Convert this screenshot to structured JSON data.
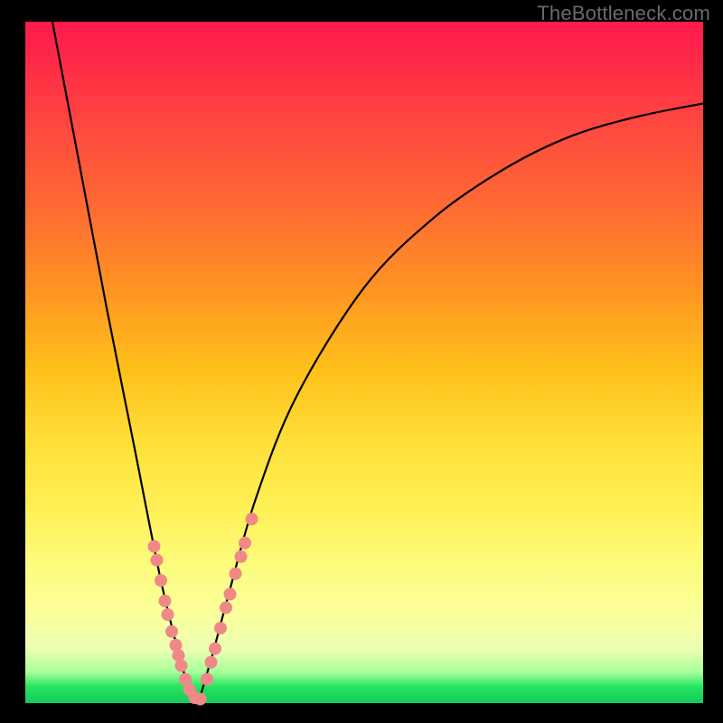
{
  "watermark": "TheBottleneck.com",
  "chart_data": {
    "type": "line",
    "title": "",
    "xlabel": "",
    "ylabel": "",
    "xlim": [
      0,
      100
    ],
    "ylim": [
      0,
      100
    ],
    "description": "Asymmetric V-shaped bottleneck curve over a rainbow gradient (red=top, green=bottom). Curve minimum near x≈25, y≈0. Left branch rises steeply to top-left; right branch rises more slowly toward upper-right. Pink marker clusters along both branches near the minimum.",
    "series": [
      {
        "name": "bottleneck-curve",
        "x": [
          4,
          8,
          12,
          16,
          20,
          23,
          25,
          27,
          30,
          34,
          40,
          50,
          60,
          70,
          80,
          90,
          100
        ],
        "y": [
          100,
          79,
          58,
          38,
          18,
          6,
          0,
          5,
          16,
          30,
          45,
          61,
          71,
          78,
          83,
          86,
          88
        ]
      }
    ],
    "markers": [
      {
        "branch": "left",
        "x": 19.0,
        "y": 23
      },
      {
        "branch": "left",
        "x": 19.4,
        "y": 21
      },
      {
        "branch": "left",
        "x": 20.0,
        "y": 18
      },
      {
        "branch": "left",
        "x": 20.6,
        "y": 15
      },
      {
        "branch": "left",
        "x": 21.0,
        "y": 13
      },
      {
        "branch": "left",
        "x": 21.6,
        "y": 10.5
      },
      {
        "branch": "left",
        "x": 22.2,
        "y": 8.5
      },
      {
        "branch": "left",
        "x": 22.6,
        "y": 7.0
      },
      {
        "branch": "left",
        "x": 23.0,
        "y": 5.5
      },
      {
        "branch": "left",
        "x": 23.6,
        "y": 3.5
      },
      {
        "branch": "left",
        "x": 24.2,
        "y": 2.0
      },
      {
        "branch": "left",
        "x": 25.0,
        "y": 0.8
      },
      {
        "branch": "left",
        "x": 25.8,
        "y": 0.6
      },
      {
        "branch": "right",
        "x": 26.8,
        "y": 3.5
      },
      {
        "branch": "right",
        "x": 27.4,
        "y": 6.0
      },
      {
        "branch": "right",
        "x": 28.0,
        "y": 8.0
      },
      {
        "branch": "right",
        "x": 28.8,
        "y": 11.0
      },
      {
        "branch": "right",
        "x": 29.6,
        "y": 14.0
      },
      {
        "branch": "right",
        "x": 30.2,
        "y": 16.0
      },
      {
        "branch": "right",
        "x": 31.0,
        "y": 19.0
      },
      {
        "branch": "right",
        "x": 31.8,
        "y": 21.5
      },
      {
        "branch": "right",
        "x": 32.4,
        "y": 23.5
      },
      {
        "branch": "right",
        "x": 33.4,
        "y": 27.0
      }
    ],
    "colors": {
      "curve": "#000000",
      "marker_fill": "#f08888",
      "gradient_top": "#ff1a4c",
      "gradient_bottom": "#14c95c"
    }
  }
}
